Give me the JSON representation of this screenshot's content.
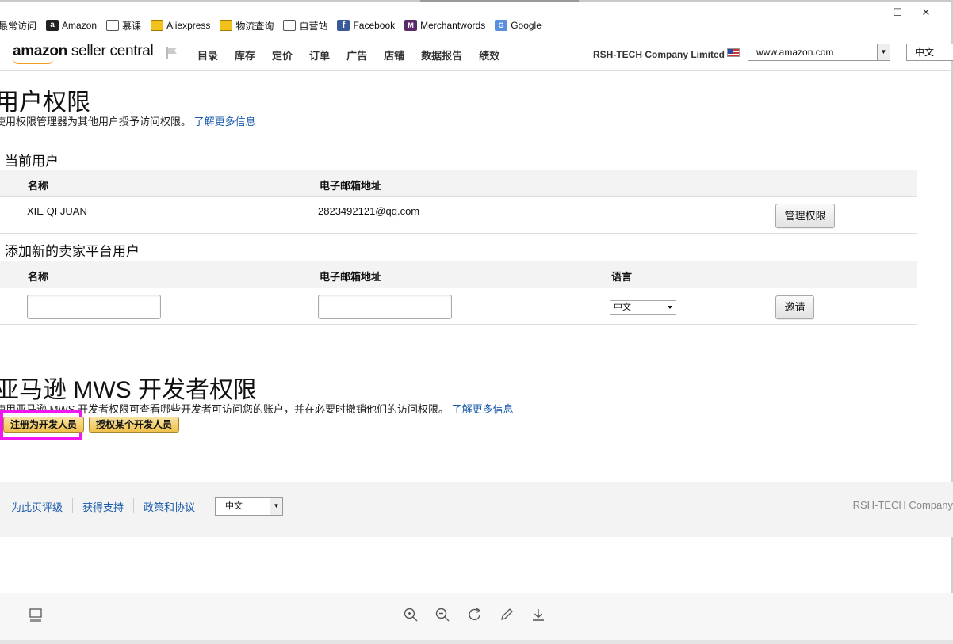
{
  "window": {
    "minimize": "–",
    "maximize": "☐",
    "close": "✕"
  },
  "bookmarks": [
    {
      "label": "最常访问",
      "icon": "none"
    },
    {
      "label": "Amazon",
      "icon": "amazon-icon"
    },
    {
      "label": "慕课",
      "icon": "globe-icon"
    },
    {
      "label": "Aliexpress",
      "icon": "yellow-folder-icon"
    },
    {
      "label": "物流查询",
      "icon": "yellow-folder-icon"
    },
    {
      "label": "自营站",
      "icon": "globe-icon"
    },
    {
      "label": "Facebook",
      "icon": "facebook-icon"
    },
    {
      "label": "Merchantwords",
      "icon": "merchantwords-icon"
    },
    {
      "label": "Google",
      "icon": "google-icon"
    }
  ],
  "header": {
    "logo_bold": "amazon",
    "logo_rest": " seller central",
    "nav": [
      "目录",
      "库存",
      "定价",
      "订单",
      "广告",
      "店铺",
      "数据报告",
      "绩效"
    ],
    "company": "RSH-TECH Company Limited",
    "marketplace": "www.amazon.com",
    "language": "中文"
  },
  "page": {
    "title": "用户权限",
    "subtitle": "使用权限管理器为其他用户授予访问权限。",
    "learn_more": "了解更多信息"
  },
  "current_users": {
    "title": "当前用户",
    "col_name": "名称",
    "col_email": "电子邮箱地址",
    "rows": [
      {
        "name": "XIE QI JUAN",
        "email": "2823492121@qq.com",
        "action": "管理权限"
      }
    ]
  },
  "add_user": {
    "title": "添加新的卖家平台用户",
    "col_name": "名称",
    "col_email": "电子邮箱地址",
    "col_language": "语言",
    "name_value": "",
    "email_value": "",
    "language_value": "中文",
    "invite": "邀请"
  },
  "mws": {
    "title": "亚马逊 MWS 开发者权限",
    "subtitle": "使用亚马逊 MWS 开发者权限可查看哪些开发者可访问您的账户，并在必要时撤销他们的访问权限。",
    "learn_more": "了解更多信息",
    "register_btn": "注册为开发人员",
    "authorize_btn": "授权某个开发人员"
  },
  "footer": {
    "links": [
      "为此页评级",
      "获得支持",
      "政策和协议"
    ],
    "language": "中文",
    "copyright": "RSH-TECH Company"
  },
  "colors": {
    "highlight": "#f018ee",
    "link": "#1a5bab",
    "gold_button": "#f0c14b",
    "logo_smile": "#f29b1d"
  }
}
